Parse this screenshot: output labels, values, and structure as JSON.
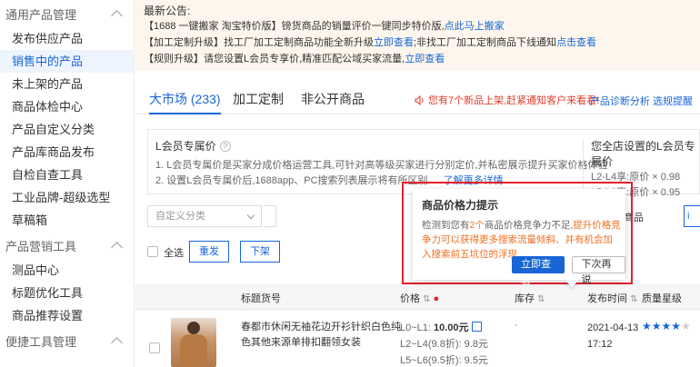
{
  "sidebar": {
    "group1_title": "通用产品管理",
    "items": [
      "发布供应产品",
      "销售中的产品",
      "未上架的产品",
      "商品体检中心",
      "产品自定义分类",
      "产品库商品发布",
      "自检自查工具",
      "工业品牌-超级选型",
      "草稿箱"
    ],
    "group2_title": "产品营销工具",
    "items2": [
      "测品中心",
      "标题优化工具",
      "商品推荐设置"
    ],
    "group3_title": "便捷工具管理"
  },
  "notice": {
    "title": "最新公告:",
    "line1": "【1688 一键搬家 淘宝特价版】镑货商品的销量评价一键同步特价版,",
    "line1_link": "点此马上搬家",
    "line2": "【加工定制升级】找工厂加工定制商品功能全新升级",
    "line2_link1": "立即查看",
    "line2_mid": ";非找工厂加工定制商品下线通知",
    "line2_link2": "点击查看",
    "line3": "【规则升级】请您设置L会员专享价,精准匹配公域买家流量,",
    "line3_link": "立即查看"
  },
  "tabs": {
    "market": "大市场 (233)",
    "custom": "加工定制",
    "nonpublic": "非公开商品",
    "message": "您有7个新品上架,赶紧通知客户来看看!",
    "links": "产品诊断分析  选规提醒"
  },
  "lbox": {
    "title": "L会员专属价",
    "line1": "1. L会员专属价是买家分成价格运营工具,可针对高等级买家进行分别定价,并私密展示提升买家价格体验",
    "line2": "2. 设置L会员专属价后,1688app、PC搜索列表展示将有所区别",
    "line2_link": "了解更多详情",
    "right_title": "您全店设置的L会员专属价",
    "right_l1": "L2-L4享:原价 × 0.98",
    "right_l2": "L5-L6享:原价 × 0.95"
  },
  "filter": {
    "select_placeholder": "自定义分类",
    "right_label": "价的商品",
    "edge_label": "i"
  },
  "actions": {
    "select_all": "全选",
    "republish": "重发",
    "offline": "下架"
  },
  "table": {
    "col_title": "标题货号",
    "col_price": "价格",
    "col_stock": "库存",
    "col_time": "发布时间",
    "col_quality": "质量星级"
  },
  "row": {
    "name": "春都市休闲无袖花边开衫针织白色纯色其他来源单排扣翻领女装",
    "p1_label": "L0~L1:",
    "p1_value": "10.00元",
    "p2_label": "L2~L4(9.8折):",
    "p2_value": "9.8元",
    "p3_label": "L5~L6(9.5折):",
    "p3_value": "9.5元",
    "stock": "-",
    "time": "2021-04-13 17:12",
    "stars_on": 4,
    "stars_total": 5
  },
  "popup": {
    "title": "商品价格力提示",
    "text_a": "检测到您有",
    "text_count": "2个",
    "text_b": "商品价格竞争力不足,",
    "text_hl": "提升价格竞争力可以获得更多搜索流量倾斜、并有机会加入搜索前五坑位的浮现",
    "btn_primary": "立即查看",
    "btn_secondary": "下次再说"
  },
  "colors": {
    "accent": "#1866d6",
    "alert_red": "#e5202a",
    "highlight_orange": "#f07022",
    "notice_bg": "#fdf6ec"
  }
}
